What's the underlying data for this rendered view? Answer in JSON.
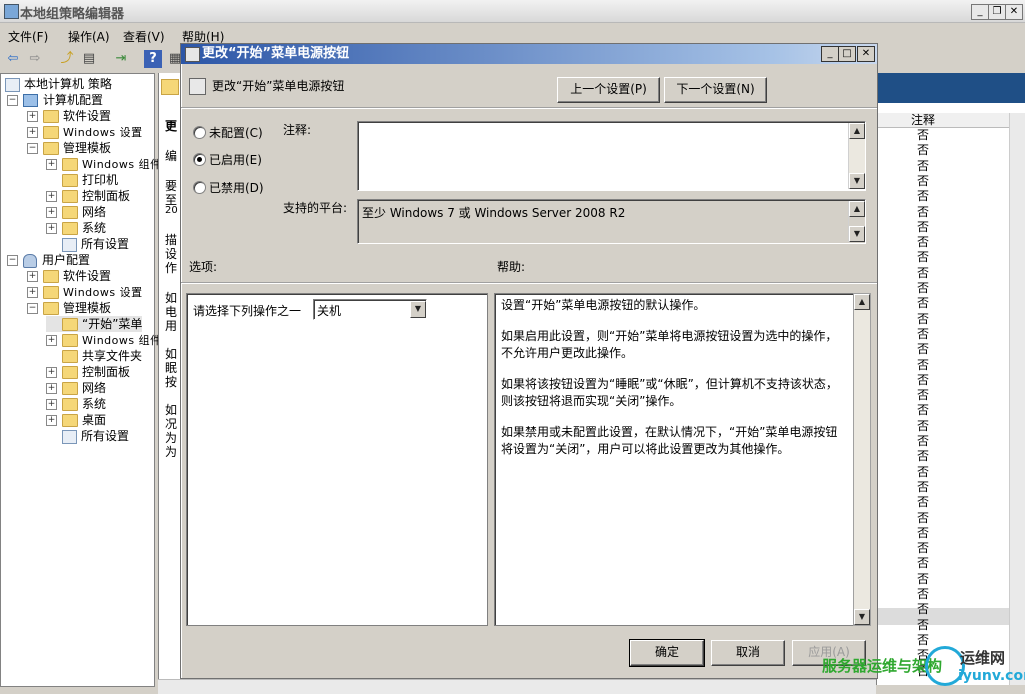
{
  "window": {
    "title": "本地组策略编辑器",
    "minimize": "_",
    "restore": "❐",
    "close": "✕"
  },
  "menubar": [
    "文件(F)",
    "操作(A)",
    "查看(V)",
    "帮助(H)"
  ],
  "toolbar": {
    "back": "⇦",
    "forward": "⇨",
    "up": "⤴",
    "show_hide": "▤",
    "export": "⇥",
    "help": "?",
    "filter": "▦"
  },
  "tree": {
    "root": "本地计算机 策略",
    "computer_config": "计算机配置",
    "cc_software": "软件设置",
    "cc_windows": "Windows 设置",
    "cc_admin": "管理模板",
    "cc_win_components": "Windows 组件",
    "cc_printers": "打印机",
    "cc_control_panel": "控制面板",
    "cc_network": "网络",
    "cc_system": "系统",
    "cc_all_settings": "所有设置",
    "user_config": "用户配置",
    "uc_software": "软件设置",
    "uc_windows": "Windows 设置",
    "uc_admin": "管理模板",
    "uc_start_menu": "“开始”菜单",
    "uc_win_components": "Windows 组件",
    "uc_shared_folders": "共享文件夹",
    "uc_control_panel": "控制面板",
    "uc_network": "网络",
    "uc_system": "系统",
    "uc_desktop": "桌面",
    "uc_all_settings": "所有设置"
  },
  "middle_fragments": [
    "更",
    "编",
    "要",
    "至",
    "20",
    "描",
    "设",
    "作",
    "如",
    "电",
    "用",
    "如",
    "眠",
    "按",
    "如",
    "况",
    "为",
    "为"
  ],
  "right_pane": {
    "column_header": "注释",
    "values": [
      "否",
      "否",
      "否",
      "否",
      "否",
      "否",
      "否",
      "否",
      "否",
      "否",
      "否",
      "否",
      "否",
      "否",
      "否",
      "否",
      "否",
      "否",
      "否",
      "否",
      "否",
      "否",
      "否",
      "否",
      "否",
      "否",
      "否",
      "否",
      "否",
      "否",
      "否",
      "否",
      "否",
      "否",
      "否",
      "否"
    ]
  },
  "dialog": {
    "title": "更改“开始”菜单电源按钮",
    "header_label": "更改“开始”菜单电源按钮",
    "prev_button": "上一个设置(P)",
    "next_button": "下一个设置(N)",
    "options": {
      "not_configured": "未配置(C)",
      "enabled": "已启用(E)",
      "disabled": "已禁用(D)",
      "selected": "enabled"
    },
    "comment_label": "注释:",
    "comment_value": "",
    "platform_label": "支持的平台:",
    "platform_value": "至少 Windows 7 或 Windows Server 2008 R2",
    "options_label": "选项:",
    "help_label": "帮助:",
    "select_label": "请选择下列操作之一",
    "select_value": "关机",
    "help_paragraphs": [
      "设置“开始”菜单电源按钮的默认操作。",
      "如果启用此设置，则“开始”菜单将电源按钮设置为选中的操作，不允许用户更改此操作。",
      "如果将该按钮设置为“睡眠”或“休眠”，但计算机不支持该状态，则该按钮将退而实现“关闭”操作。",
      "如果禁用或未配置此设置，在默认情况下，“开始”菜单电源按钮将设置为“关闭”，用户可以将此设置更改为其他操作。"
    ],
    "ok_button": "确定",
    "cancel_button": "取消",
    "apply_button": "应用(A)"
  },
  "watermark": {
    "text": "服务器运维与架构",
    "site": "运维网",
    "url": "iyunv.com"
  }
}
